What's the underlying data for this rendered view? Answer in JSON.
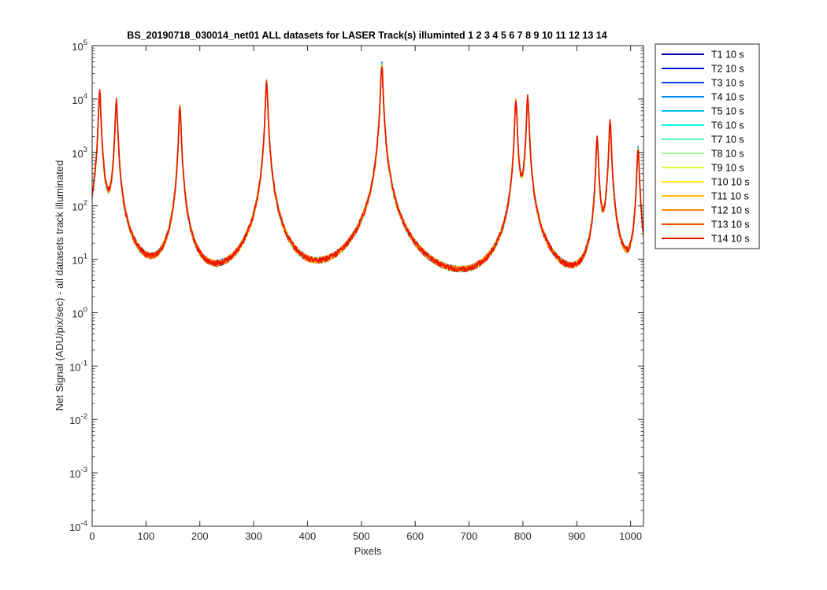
{
  "chart_data": {
    "type": "line",
    "title": "BS_20190718_030014_net01 ALL datasets for LASER  Track(s) illuminted 1   2   3   4   5   6   7   8   9  10  11  12  13  14",
    "xlabel": "Pixels",
    "ylabel": "Net Signal (ADU/pix/sec) - all datasets track illuminated",
    "xlim": [
      0,
      1024
    ],
    "ylim": [
      0.0001,
      100000
    ],
    "yscale": "log",
    "xticks": [
      0,
      100,
      200,
      300,
      400,
      500,
      600,
      700,
      800,
      900,
      1000
    ],
    "yticks": [
      {
        "value": 0.0001,
        "base": "10",
        "exp": "-4"
      },
      {
        "value": 0.001,
        "base": "10",
        "exp": "-3"
      },
      {
        "value": 0.01,
        "base": "10",
        "exp": "-2"
      },
      {
        "value": 0.1,
        "base": "10",
        "exp": "-1"
      },
      {
        "value": 1,
        "base": "10",
        "exp": "0"
      },
      {
        "value": 10,
        "base": "10",
        "exp": "1"
      },
      {
        "value": 100,
        "base": "10",
        "exp": "2"
      },
      {
        "value": 1000,
        "base": "10",
        "exp": "3"
      },
      {
        "value": 10000,
        "base": "10",
        "exp": "4"
      },
      {
        "value": 100000,
        "base": "10",
        "exp": "5"
      }
    ],
    "grid": false,
    "legend_position": "outside-right",
    "peaks": [
      {
        "pixel": 14,
        "value": 14000
      },
      {
        "pixel": 45,
        "value": 9500
      },
      {
        "pixel": 163,
        "value": 7000
      },
      {
        "pixel": 324,
        "value": 21000
      },
      {
        "pixel": 538,
        "value": 45000
      },
      {
        "pixel": 787,
        "value": 9500
      },
      {
        "pixel": 809,
        "value": 11000
      },
      {
        "pixel": 938,
        "value": 1900
      },
      {
        "pixel": 962,
        "value": 3800
      },
      {
        "pixel": 1014,
        "value": 1200
      }
    ],
    "series": [
      {
        "name": "T1 10 s",
        "color": "#0000b4"
      },
      {
        "name": "T2 10 s",
        "color": "#0010dc"
      },
      {
        "name": "T3 10 s",
        "color": "#0048f8"
      },
      {
        "name": "T4 10 s",
        "color": "#0088ff"
      },
      {
        "name": "T5 10 s",
        "color": "#00c4ff"
      },
      {
        "name": "T6 10 s",
        "color": "#18f0f0"
      },
      {
        "name": "T7 10 s",
        "color": "#5cf8c0"
      },
      {
        "name": "T8 10 s",
        "color": "#9cfc88"
      },
      {
        "name": "T9 10 s",
        "color": "#d0fc40"
      },
      {
        "name": "T10 10 s",
        "color": "#ffec00"
      },
      {
        "name": "T11 10 s",
        "color": "#ffc000"
      },
      {
        "name": "T12 10 s",
        "color": "#ff8c00"
      },
      {
        "name": "T13 10 s",
        "color": "#ff5000"
      },
      {
        "name": "T14 10 s",
        "color": "#ec1000"
      }
    ]
  }
}
